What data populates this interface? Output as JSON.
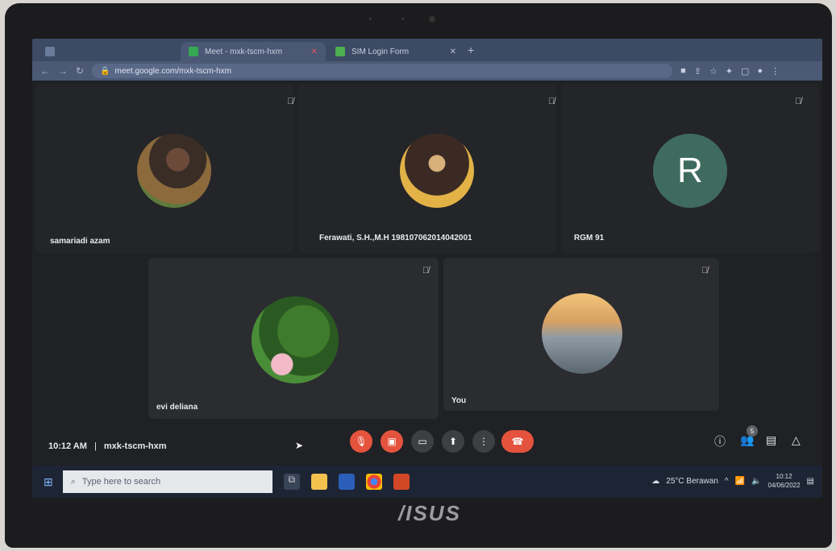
{
  "browser": {
    "tabs": [
      {
        "label": "Meet - mxk-tscm-hxm",
        "active": true
      },
      {
        "label": "SIM Login Form",
        "active": false
      }
    ],
    "url": "meet.google.com/mxk-tscm-hxm"
  },
  "participants": [
    {
      "name": "samariadi azam",
      "muted": true
    },
    {
      "name": "Ferawati, S.H.,M.H 198107062014042001",
      "muted": true
    },
    {
      "name": "RGM 91",
      "initial": "R",
      "muted": true
    },
    {
      "name": "evi deliana",
      "muted": true
    },
    {
      "name": "You",
      "muted": true
    }
  ],
  "meeting": {
    "time": "10:12 AM",
    "separator": "|",
    "code": "mxk-tscm-hxm",
    "people_badge": "5"
  },
  "taskbar": {
    "search_placeholder": "Type here to search",
    "weather": "25°C Berawan",
    "clock_time": "10:12",
    "clock_date": "04/06/2022"
  },
  "laptop_brand": "/ISUS",
  "colors": {
    "meet_bg": "#202124",
    "tile_bg": "#2b2c30",
    "control_red": "#e4533d",
    "control_grey": "#3c4043",
    "avatar_r": "#3f6b5f"
  }
}
